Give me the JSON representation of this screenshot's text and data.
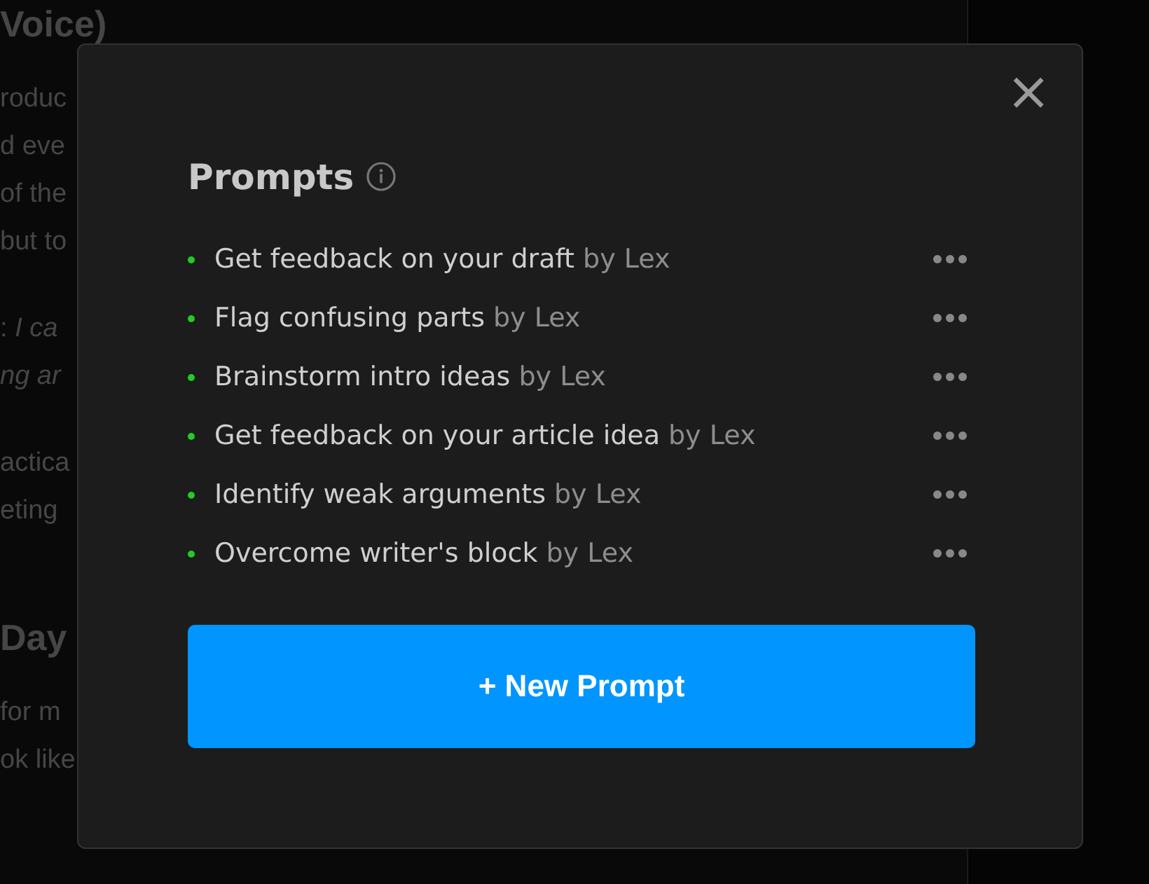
{
  "document": {
    "lines": [
      {
        "kind": "heading",
        "text": "Voice)"
      },
      {
        "kind": "body",
        "text": "roduc"
      },
      {
        "kind": "body",
        "text": "d eve"
      },
      {
        "kind": "body",
        "text": "of the"
      },
      {
        "kind": "body",
        "text": "but to"
      },
      {
        "kind": "gap"
      },
      {
        "kind": "body",
        "text": ": *I ca*"
      },
      {
        "kind": "italic",
        "text": "ng ar"
      },
      {
        "kind": "gap"
      },
      {
        "kind": "body",
        "text": "actica"
      },
      {
        "kind": "body",
        "text": "eting"
      },
      {
        "kind": "gap"
      },
      {
        "kind": "gap"
      },
      {
        "kind": "heading",
        "text": "Day"
      },
      {
        "kind": "body",
        "text": "for m"
      },
      {
        "kind": "body",
        "text": "ok like"
      }
    ]
  },
  "dialog": {
    "title": "Prompts",
    "close": "×",
    "prompts": [
      {
        "name": "Get feedback on your draft",
        "author": "by Lex",
        "color": "#22cc22"
      },
      {
        "name": "Flag confusing parts",
        "author": "by Lex",
        "color": "#22cc22"
      },
      {
        "name": "Brainstorm intro ideas",
        "author": "by Lex",
        "color": "#22cc22"
      },
      {
        "name": "Get feedback on your article idea",
        "author": "by Lex",
        "color": "#22cc22"
      },
      {
        "name": "Identify weak arguments",
        "author": "by Lex",
        "color": "#22cc22"
      },
      {
        "name": "Overcome writer's block",
        "author": "by Lex",
        "color": "#22cc22"
      }
    ],
    "button": "+ New Prompt"
  }
}
